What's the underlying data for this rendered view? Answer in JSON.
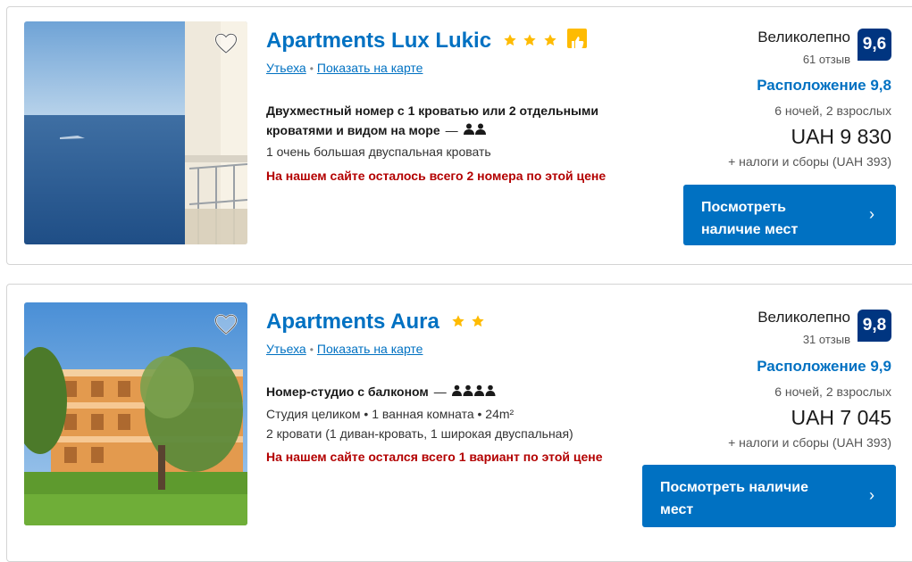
{
  "listings": [
    {
      "name": "Apartments Lux Lukic",
      "stars": 3,
      "area": "Утьеха",
      "map_link": "Показать на карте",
      "room_title": "Двухместный номер с 1 кроватью или 2 отдельными кроватями и видом на море",
      "room_occupancy": 2,
      "room_details": [
        "1 очень большая двуспальная кровать"
      ],
      "availability_warning": "На нашем сайте осталось всего 2 номера по этой цене",
      "rating_word": "Великолепно",
      "review_count": "61 отзыв",
      "score": "9,6",
      "location_score": "Расположение 9,8",
      "stay_info": "6 ночей, 2 взрослых",
      "price": "UAH 9 830",
      "taxes": "+ налоги и сборы (UAH 393)",
      "cta": "Посмотреть наличие мест"
    },
    {
      "name": "Apartments Aura",
      "stars": 2,
      "area": "Утьеха",
      "map_link": "Показать на карте",
      "room_title": "Номер-студио с балконом",
      "room_occupancy": 4,
      "room_details": [
        "Студия целиком  • 1 ванная комната • 24m²",
        "2 кровати (1 диван-кровать, 1 широкая двуспальная)"
      ],
      "availability_warning": "На нашем сайте остался всего 1 вариант по этой цене",
      "rating_word": "Великолепно",
      "review_count": "31 отзыв",
      "score": "9,8",
      "location_score": "Расположение 9,9",
      "stay_info": "6 ночей, 2 взрослых",
      "price": "UAH 7 045",
      "taxes": "+ налоги и сборы (UAH 393)",
      "cta": "Посмотреть наличие мест"
    }
  ],
  "icons": {
    "favorite": "heart-outline-icon",
    "star": "star-icon",
    "preferred": "thumbs-up-icon",
    "person": "person-icon",
    "chevron": "chevron-right-icon"
  },
  "colors": {
    "link": "#0071c2",
    "score_bg": "#003580",
    "star": "#febb02",
    "warning": "#b30000",
    "button": "#0071c2"
  }
}
